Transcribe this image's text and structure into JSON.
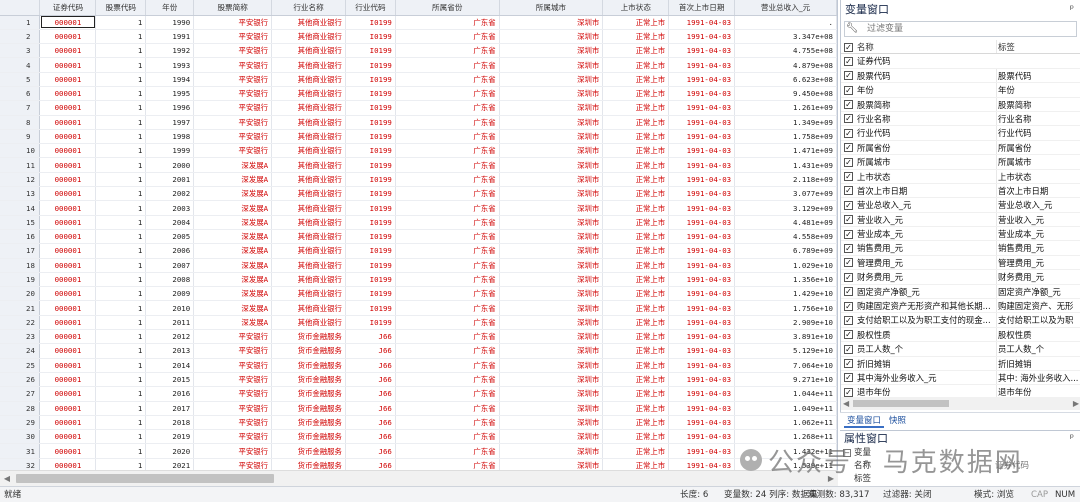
{
  "grid": {
    "columns": [
      "证券代码",
      "股票代码",
      "年份",
      "股票简称",
      "行业名称",
      "行业代码",
      "所属省份",
      "所属城市",
      "上市状态",
      "首次上市日期",
      "营业总收入_元"
    ],
    "rows": [
      [
        "1",
        "000001",
        "1",
        "1990",
        "平安银行",
        "其他商业银行",
        "I0199",
        "广东省",
        "深圳市",
        "正常上市",
        "1991-04-03",
        "."
      ],
      [
        "2",
        "000001",
        "1",
        "1991",
        "平安银行",
        "其他商业银行",
        "I0199",
        "广东省",
        "深圳市",
        "正常上市",
        "1991-04-03",
        "3.347e+08"
      ],
      [
        "3",
        "000001",
        "1",
        "1992",
        "平安银行",
        "其他商业银行",
        "I0199",
        "广东省",
        "深圳市",
        "正常上市",
        "1991-04-03",
        "4.755e+08"
      ],
      [
        "4",
        "000001",
        "1",
        "1993",
        "平安银行",
        "其他商业银行",
        "I0199",
        "广东省",
        "深圳市",
        "正常上市",
        "1991-04-03",
        "4.879e+08"
      ],
      [
        "5",
        "000001",
        "1",
        "1994",
        "平安银行",
        "其他商业银行",
        "I0199",
        "广东省",
        "深圳市",
        "正常上市",
        "1991-04-03",
        "6.623e+08"
      ],
      [
        "6",
        "000001",
        "1",
        "1995",
        "平安银行",
        "其他商业银行",
        "I0199",
        "广东省",
        "深圳市",
        "正常上市",
        "1991-04-03",
        "9.450e+08"
      ],
      [
        "7",
        "000001",
        "1",
        "1996",
        "平安银行",
        "其他商业银行",
        "I0199",
        "广东省",
        "深圳市",
        "正常上市",
        "1991-04-03",
        "1.261e+09"
      ],
      [
        "8",
        "000001",
        "1",
        "1997",
        "平安银行",
        "其他商业银行",
        "I0199",
        "广东省",
        "深圳市",
        "正常上市",
        "1991-04-03",
        "1.349e+09"
      ],
      [
        "9",
        "000001",
        "1",
        "1998",
        "平安银行",
        "其他商业银行",
        "I0199",
        "广东省",
        "深圳市",
        "正常上市",
        "1991-04-03",
        "1.758e+09"
      ],
      [
        "10",
        "000001",
        "1",
        "1999",
        "平安银行",
        "其他商业银行",
        "I0199",
        "广东省",
        "深圳市",
        "正常上市",
        "1991-04-03",
        "1.471e+09"
      ],
      [
        "11",
        "000001",
        "1",
        "2000",
        "深发展A",
        "其他商业银行",
        "I0199",
        "广东省",
        "深圳市",
        "正常上市",
        "1991-04-03",
        "1.431e+09"
      ],
      [
        "12",
        "000001",
        "1",
        "2001",
        "深发展A",
        "其他商业银行",
        "I0199",
        "广东省",
        "深圳市",
        "正常上市",
        "1991-04-03",
        "2.118e+09"
      ],
      [
        "13",
        "000001",
        "1",
        "2002",
        "深发展A",
        "其他商业银行",
        "I0199",
        "广东省",
        "深圳市",
        "正常上市",
        "1991-04-03",
        "3.077e+09"
      ],
      [
        "14",
        "000001",
        "1",
        "2003",
        "深发展A",
        "其他商业银行",
        "I0199",
        "广东省",
        "深圳市",
        "正常上市",
        "1991-04-03",
        "3.129e+09"
      ],
      [
        "15",
        "000001",
        "1",
        "2004",
        "深发展A",
        "其他商业银行",
        "I0199",
        "广东省",
        "深圳市",
        "正常上市",
        "1991-04-03",
        "4.481e+09"
      ],
      [
        "16",
        "000001",
        "1",
        "2005",
        "深发展A",
        "其他商业银行",
        "I0199",
        "广东省",
        "深圳市",
        "正常上市",
        "1991-04-03",
        "4.558e+09"
      ],
      [
        "17",
        "000001",
        "1",
        "2006",
        "深发展A",
        "其他商业银行",
        "I0199",
        "广东省",
        "深圳市",
        "正常上市",
        "1991-04-03",
        "6.789e+09"
      ],
      [
        "18",
        "000001",
        "1",
        "2007",
        "深发展A",
        "其他商业银行",
        "I0199",
        "广东省",
        "深圳市",
        "正常上市",
        "1991-04-03",
        "1.029e+10"
      ],
      [
        "19",
        "000001",
        "1",
        "2008",
        "深发展A",
        "其他商业银行",
        "I0199",
        "广东省",
        "深圳市",
        "正常上市",
        "1991-04-03",
        "1.356e+10"
      ],
      [
        "20",
        "000001",
        "1",
        "2009",
        "深发展A",
        "其他商业银行",
        "I0199",
        "广东省",
        "深圳市",
        "正常上市",
        "1991-04-03",
        "1.429e+10"
      ],
      [
        "21",
        "000001",
        "1",
        "2010",
        "深发展A",
        "其他商业银行",
        "I0199",
        "广东省",
        "深圳市",
        "正常上市",
        "1991-04-03",
        "1.756e+10"
      ],
      [
        "22",
        "000001",
        "1",
        "2011",
        "深发展A",
        "其他商业银行",
        "I0199",
        "广东省",
        "深圳市",
        "正常上市",
        "1991-04-03",
        "2.909e+10"
      ],
      [
        "23",
        "000001",
        "1",
        "2012",
        "平安银行",
        "货币金融服务",
        "J66",
        "广东省",
        "深圳市",
        "正常上市",
        "1991-04-03",
        "3.891e+10"
      ],
      [
        "24",
        "000001",
        "1",
        "2013",
        "平安银行",
        "货币金融服务",
        "J66",
        "广东省",
        "深圳市",
        "正常上市",
        "1991-04-03",
        "5.129e+10"
      ],
      [
        "25",
        "000001",
        "1",
        "2014",
        "平安银行",
        "货币金融服务",
        "J66",
        "广东省",
        "深圳市",
        "正常上市",
        "1991-04-03",
        "7.064e+10"
      ],
      [
        "26",
        "000001",
        "1",
        "2015",
        "平安银行",
        "货币金融服务",
        "J66",
        "广东省",
        "深圳市",
        "正常上市",
        "1991-04-03",
        "9.271e+10"
      ],
      [
        "27",
        "000001",
        "1",
        "2016",
        "平安银行",
        "货币金融服务",
        "J66",
        "广东省",
        "深圳市",
        "正常上市",
        "1991-04-03",
        "1.044e+11"
      ],
      [
        "28",
        "000001",
        "1",
        "2017",
        "平安银行",
        "货币金融服务",
        "J66",
        "广东省",
        "深圳市",
        "正常上市",
        "1991-04-03",
        "1.049e+11"
      ],
      [
        "29",
        "000001",
        "1",
        "2018",
        "平安银行",
        "货币金融服务",
        "J66",
        "广东省",
        "深圳市",
        "正常上市",
        "1991-04-03",
        "1.062e+11"
      ],
      [
        "30",
        "000001",
        "1",
        "2019",
        "平安银行",
        "货币金融服务",
        "J66",
        "广东省",
        "深圳市",
        "正常上市",
        "1991-04-03",
        "1.268e+11"
      ],
      [
        "31",
        "000001",
        "1",
        "2020",
        "平安银行",
        "货币金融服务",
        "J66",
        "广东省",
        "深圳市",
        "正常上市",
        "1991-04-03",
        "1.432e+11"
      ],
      [
        "32",
        "000001",
        "1",
        "2021",
        "平安银行",
        "货币金融服务",
        "J66",
        "广东省",
        "深圳市",
        "正常上市",
        "1991-04-03",
        "1.539e+11"
      ]
    ]
  },
  "varwin": {
    "title": "变量窗口",
    "pin": "ᵖ",
    "filter_placeholder": "过滤变量",
    "header": {
      "name": "名称",
      "label": "标签"
    },
    "vars": [
      {
        "name": "证券代码",
        "label": ""
      },
      {
        "name": "股票代码",
        "label": "股票代码"
      },
      {
        "name": "年份",
        "label": "年份"
      },
      {
        "name": "股票简称",
        "label": "股票简称"
      },
      {
        "name": "行业名称",
        "label": "行业名称"
      },
      {
        "name": "行业代码",
        "label": "行业代码"
      },
      {
        "name": "所属省份",
        "label": "所属省份"
      },
      {
        "name": "所属城市",
        "label": "所属城市"
      },
      {
        "name": "上市状态",
        "label": "上市状态"
      },
      {
        "name": "首次上市日期",
        "label": "首次上市日期"
      },
      {
        "name": "营业总收入_元",
        "label": "营业总收入_元"
      },
      {
        "name": "营业收入_元",
        "label": "营业收入_元"
      },
      {
        "name": "营业成本_元",
        "label": "营业成本_元"
      },
      {
        "name": "销售费用_元",
        "label": "销售费用_元"
      },
      {
        "name": "管理费用_元",
        "label": "管理费用_元"
      },
      {
        "name": "财务费用_元",
        "label": "财务费用_元"
      },
      {
        "name": "固定资产净额_元",
        "label": "固定资产净额_元"
      },
      {
        "name": "购建固定资产无形资产和其他长期...",
        "label": "购建固定资产、无形"
      },
      {
        "name": "支付给职工以及为职工支付的现金...",
        "label": "支付给职工以及为职"
      },
      {
        "name": "股权性质",
        "label": "股权性质"
      },
      {
        "name": "员工人数_个",
        "label": "员工人数_个"
      },
      {
        "name": "折旧摊销",
        "label": "折旧摊销"
      },
      {
        "name": "其中海外业务收入_元",
        "label": "其中: 海外业务收入..."
      },
      {
        "name": "退市年份",
        "label": "退市年份"
      }
    ]
  },
  "tabs": [
    "变量窗口",
    "快照"
  ],
  "propwin": {
    "title": "属性窗口",
    "pin": "ᵖ",
    "section": "变量",
    "name_label": "名称",
    "name_value": "证券代码",
    "next_label": "标签"
  },
  "watermark": "公众号 · 马克数据网",
  "status": {
    "ready": "就绪",
    "length": "长度: 6",
    "vars": "变量数: 24 列序: 数据集",
    "obs": "观测数: 83,317",
    "filter": "过滤器: 关闭",
    "mode": "模式: 浏览",
    "cap": "CAP",
    "num": "NUM"
  }
}
